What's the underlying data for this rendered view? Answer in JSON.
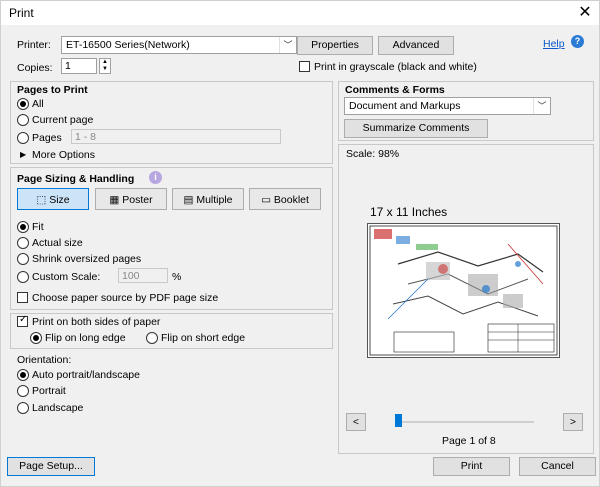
{
  "window": {
    "title": "Print"
  },
  "printer": {
    "label": "Printer:",
    "selected": "ET-16500 Series(Network)",
    "properties_label": "Properties",
    "advanced_label": "Advanced",
    "help_label": "Help"
  },
  "copies": {
    "label": "Copies:",
    "value": "1"
  },
  "grayscale": {
    "label": "Print in grayscale (black and white)",
    "checked": false
  },
  "pages_to_print": {
    "heading": "Pages to Print",
    "all": "All",
    "current_page": "Current page",
    "pages": "Pages",
    "pages_value": "1 - 8",
    "more_options": "More Options"
  },
  "page_sizing": {
    "heading": "Page Sizing & Handling",
    "tabs": [
      "Size",
      "Poster",
      "Multiple",
      "Booklet"
    ],
    "fit": "Fit",
    "actual_size": "Actual size",
    "shrink": "Shrink oversized pages",
    "custom_scale": "Custom Scale:",
    "custom_scale_value": "100",
    "percent": "%",
    "paper_source": "Choose paper source by PDF page size"
  },
  "duplex": {
    "both_sides": "Print on both sides of paper",
    "flip_long": "Flip on long edge",
    "flip_short": "Flip on short edge"
  },
  "orientation": {
    "label": "Orientation:",
    "auto": "Auto portrait/landscape",
    "portrait": "Portrait",
    "landscape": "Landscape"
  },
  "comments": {
    "heading": "Comments & Forms",
    "selected": "Document and Markups",
    "summarize": "Summarize Comments"
  },
  "preview": {
    "scale": "Scale:  98%",
    "paper_size": "17 x 11 Inches",
    "page_indicator": "Page 1 of 8",
    "prev": "<",
    "next": ">",
    "slider_fraction": 0.0
  },
  "footer": {
    "page_setup": "Page Setup...",
    "print": "Print",
    "cancel": "Cancel"
  },
  "colors": {
    "accent": "#0078d7",
    "selected_tab_bg": "#cce4f7"
  }
}
